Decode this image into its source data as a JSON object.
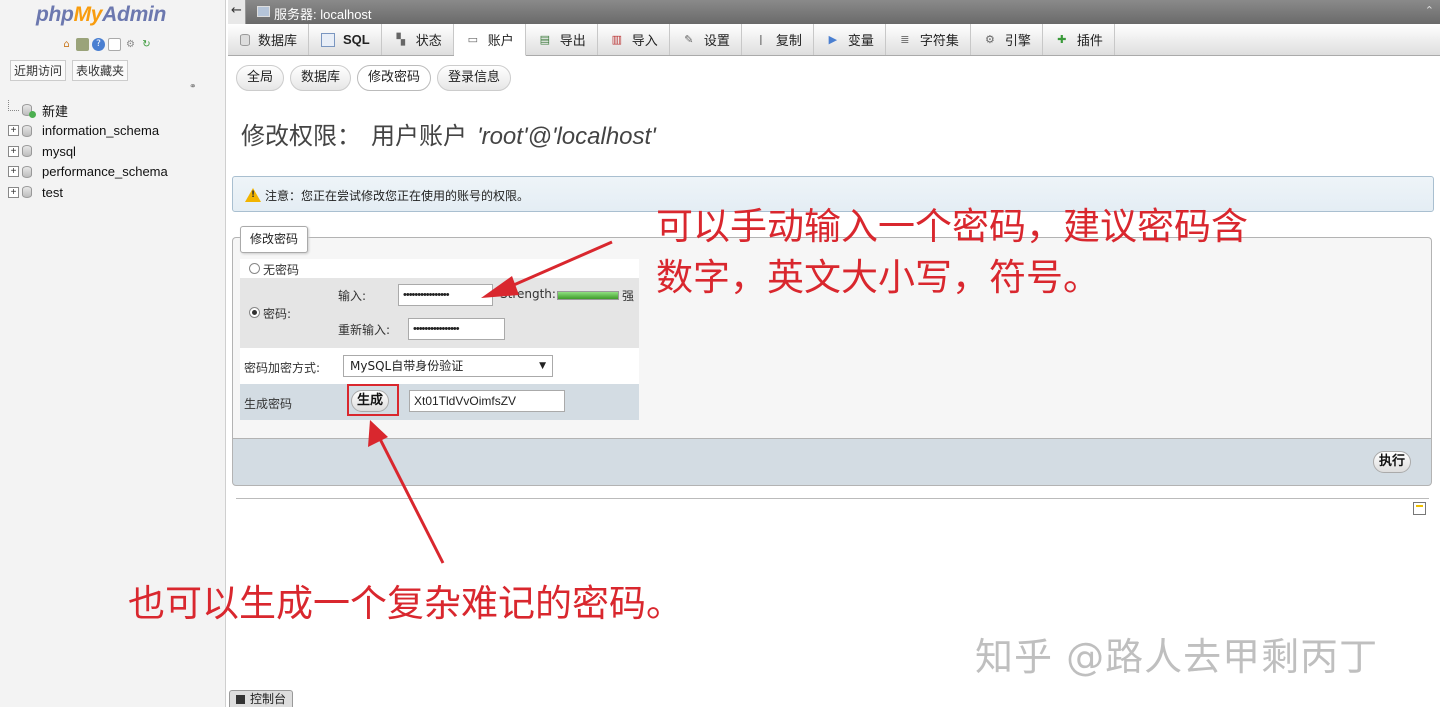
{
  "nav": {
    "logo": {
      "php": "php",
      "my": "My",
      "admin": "Admin"
    },
    "icons": [
      "home-icon",
      "database-icon",
      "help-icon",
      "docs-icon",
      "settings-icon",
      "reload-icon"
    ],
    "tabs": [
      "近期访问",
      "表收藏夹"
    ],
    "tree": [
      {
        "label": "新建",
        "kind": "new"
      },
      {
        "label": "information_schema",
        "kind": "db"
      },
      {
        "label": "mysql",
        "kind": "db"
      },
      {
        "label": "performance_schema",
        "kind": "db"
      },
      {
        "label": "test",
        "kind": "db"
      }
    ]
  },
  "serverbar": {
    "label": "服务器: localhost"
  },
  "maintabs": [
    {
      "label": "数据库",
      "icon": "database-icon"
    },
    {
      "label": "SQL",
      "icon": "sql-icon"
    },
    {
      "label": "状态",
      "icon": "status-icon"
    },
    {
      "label": "账户",
      "icon": "accounts-icon",
      "active": true
    },
    {
      "label": "导出",
      "icon": "export-icon"
    },
    {
      "label": "导入",
      "icon": "import-icon"
    },
    {
      "label": "设置",
      "icon": "settings-icon"
    },
    {
      "label": "复制",
      "icon": "replication-icon"
    },
    {
      "label": "变量",
      "icon": "variables-icon"
    },
    {
      "label": "字符集",
      "icon": "charset-icon"
    },
    {
      "label": "引擎",
      "icon": "engine-icon"
    },
    {
      "label": "插件",
      "icon": "plugin-icon"
    }
  ],
  "subtabs": [
    {
      "label": "全局"
    },
    {
      "label": "数据库"
    },
    {
      "label": "修改密码",
      "active": true
    },
    {
      "label": "登录信息"
    }
  ],
  "page": {
    "title": "修改权限：",
    "title_sub": "用户账户",
    "user": "'root'@'localhost'",
    "notice": "注意：您正在尝试修改您正在使用的账号的权限。"
  },
  "password_form": {
    "legend": "修改密码",
    "no_password_label": "无密码",
    "password_label": "密码:",
    "enter_label": "输入:",
    "reenter_label": "重新输入:",
    "password_value": "••••••••••••••••",
    "reenter_value": "••••••••••••••••",
    "strength_label": "Strength:",
    "strength_text": "强",
    "strength_fraction": 1.0,
    "hash_label": "密码加密方式:",
    "hash_selected": "MySQL自带身份验证",
    "generate_label": "生成密码",
    "generate_button": "生成",
    "generated_value": "Xt01TldVvOimfsZV",
    "submit_button": "执行"
  },
  "console": {
    "label": "控制台"
  },
  "annotations": {
    "line1": "可以手动输入一个密码，建议密码含",
    "line2": "数字，英文大小写，符号。",
    "line3": "也可以生成一个复杂难记的密码。",
    "color": "#d9272e"
  },
  "watermark": "知乎 @路人去甲剩丙丁",
  "colors": {
    "link": "#235a81",
    "nav_bg": "#f3f3f3",
    "gen_row_bg": "#d3dce3"
  }
}
